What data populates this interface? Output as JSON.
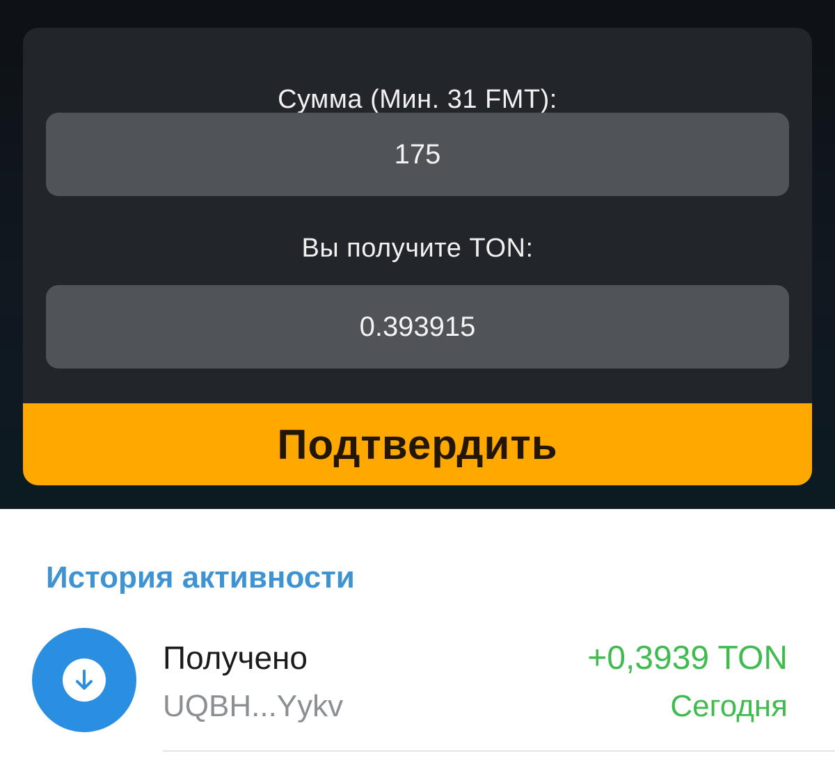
{
  "form": {
    "amount_label": "Сумма (Мин. 31 FMT):",
    "amount_value": "175",
    "receive_label": "Вы получите TON:",
    "receive_value": "0.393915",
    "confirm_label": "Подтвердить"
  },
  "history": {
    "title": "История активности",
    "items": [
      {
        "icon": "arrow-down-icon",
        "title": "Получено",
        "address": "UQBH...Yykv",
        "amount": "+0,3939 TON",
        "date": "Сегодня"
      }
    ]
  },
  "colors": {
    "accent_button": "#ffa800",
    "history_title": "#3e93d2",
    "incoming_amount": "#3fbb4f",
    "avatar": "#2a8fe0"
  }
}
